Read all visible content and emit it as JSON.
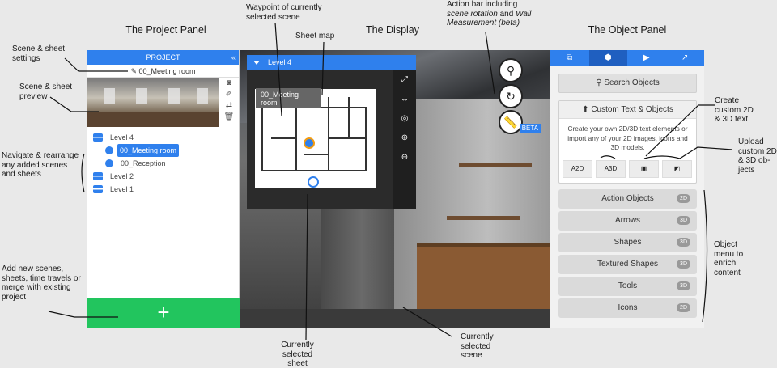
{
  "headers": {
    "project_panel": "The Project Panel",
    "display": "The Display",
    "object_panel": "The Object Panel"
  },
  "project": {
    "title": "PROJECT",
    "collapse_icon": "«",
    "scene_name": "00_Meeting room",
    "tree": [
      {
        "label": "Level 4",
        "type": "sheet"
      },
      {
        "label": "00_Meeting room",
        "type": "scene",
        "selected": true
      },
      {
        "label": "00_Reception",
        "type": "scene"
      },
      {
        "label": "Level 2",
        "type": "sheet"
      },
      {
        "label": "Level 1",
        "type": "sheet"
      }
    ],
    "add_label": "+"
  },
  "display": {
    "level_label": "Level 4",
    "bubble_label": "00_Meeting room",
    "beta_label": "BETA"
  },
  "object_panel": {
    "tabs": [
      "hierarchy-icon",
      "cube-icon",
      "video-icon",
      "external-link-icon"
    ],
    "search_label": "Search Objects",
    "custom_title": "Custom Text & Objects",
    "custom_desc": "Create your own 2D/3D text elements or import any of your 2D images, icons and 3D models.",
    "custom_icons": [
      "A2D",
      "A3D",
      "image-icon",
      "cube-icon"
    ],
    "menu": [
      {
        "label": "Action Objects",
        "badge": "2D"
      },
      {
        "label": "Arrows",
        "badge": "3D"
      },
      {
        "label": "Shapes",
        "badge": "3D"
      },
      {
        "label": "Textured Shapes",
        "badge": "3D"
      },
      {
        "label": "Tools",
        "badge": "3D"
      },
      {
        "label": "Icons",
        "badge": "2D"
      }
    ]
  },
  "annotations": {
    "scene_settings": "Scene & sheet\nsettings",
    "scene_preview": "Scene & sheet\npreview",
    "navigate": "Navigate & rearrange\nany added scenes\nand sheets",
    "add_new": "Add new scenes,\nsheets, time travels or\nmerge with existing\nproject",
    "waypoint": "Waypoint of currently\nselected scene",
    "sheet_map": "Sheet map",
    "action_bar_1": "Action bar including",
    "action_bar_2": "scene rotation",
    "action_bar_3": " and ",
    "action_bar_4": "Wall",
    "action_bar_5": "Measurement (beta)",
    "current_sheet": "Currently\nselected\nsheet",
    "current_scene": "Currently\nselected\nscene",
    "create_custom": "Create\ncustom 2D\n& 3D text",
    "upload_custom": "Upload\ncustom 2D\n& 3D ob-\njects",
    "object_menu": "Object\nmenu to\nenrich\ncontent"
  }
}
